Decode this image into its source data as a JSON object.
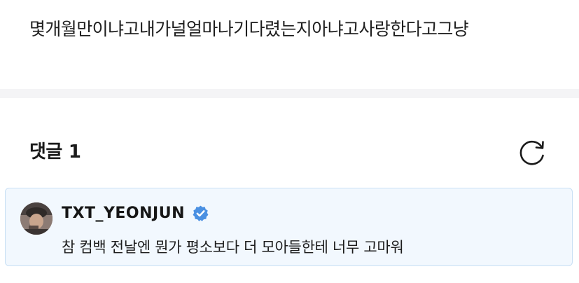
{
  "post": {
    "text": "몇개월만이냐고내가널얼마나기다렸는지아냐고사랑한다고그냥"
  },
  "comments": {
    "header_label": "댓글",
    "count": "1",
    "refresh_icon": "refresh-icon"
  },
  "comment": {
    "author": "TXT_YEONJUN",
    "verified_icon": "verified-badge-icon",
    "verified_color": "#4a90e2",
    "text": "참 컴백 전날엔 뭔가 평소보다 더 모아들한테 너무 고마워",
    "card_background": "#f2f8fe",
    "card_border": "#c7dff4"
  }
}
